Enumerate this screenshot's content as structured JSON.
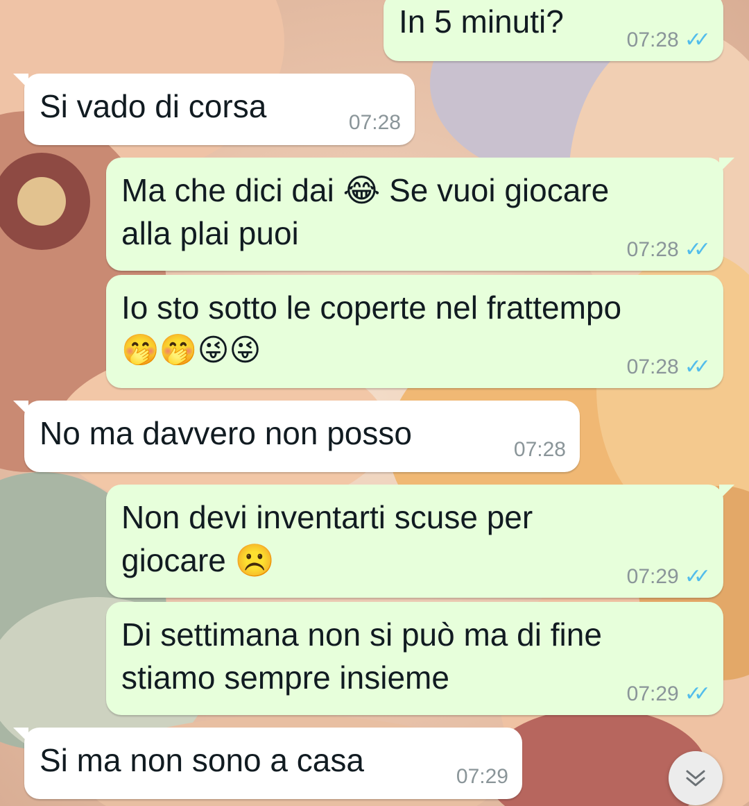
{
  "messages": [
    {
      "dir": "out",
      "text": "In 5 minuti?",
      "time": "07:28",
      "status": "read"
    },
    {
      "dir": "in",
      "text": "Si vado di corsa",
      "time": "07:28"
    },
    {
      "dir": "out",
      "line1": "Ma che dici dai 😂 Se vuoi giocare",
      "line2": "alla plai puoi",
      "time": "07:28",
      "status": "read"
    },
    {
      "dir": "out",
      "line1": "Io sto sotto le coperte nel frattempo",
      "line2": "🤭🤭😜😜",
      "time": "07:28",
      "status": "read"
    },
    {
      "dir": "in",
      "text": "No ma davvero non posso",
      "time": "07:28"
    },
    {
      "dir": "out",
      "line1": "Non devi inventarti scuse per",
      "line2": "giocare ☹️",
      "time": "07:29",
      "status": "read"
    },
    {
      "dir": "out",
      "line1": "Di settimana non si può ma di fine",
      "line2": "stiamo sempre insieme",
      "time": "07:29",
      "status": "read"
    },
    {
      "dir": "in",
      "text": "Si ma non sono a casa",
      "time": "07:29"
    }
  ],
  "icons": {
    "read_receipt": "double-check-icon",
    "scroll_down": "chevron-double-down-icon"
  },
  "colors": {
    "outgoing_bubble": "#e7ffdb",
    "incoming_bubble": "#ffffff",
    "read_tick": "#53bdeb",
    "timestamp": "#8a9599"
  }
}
